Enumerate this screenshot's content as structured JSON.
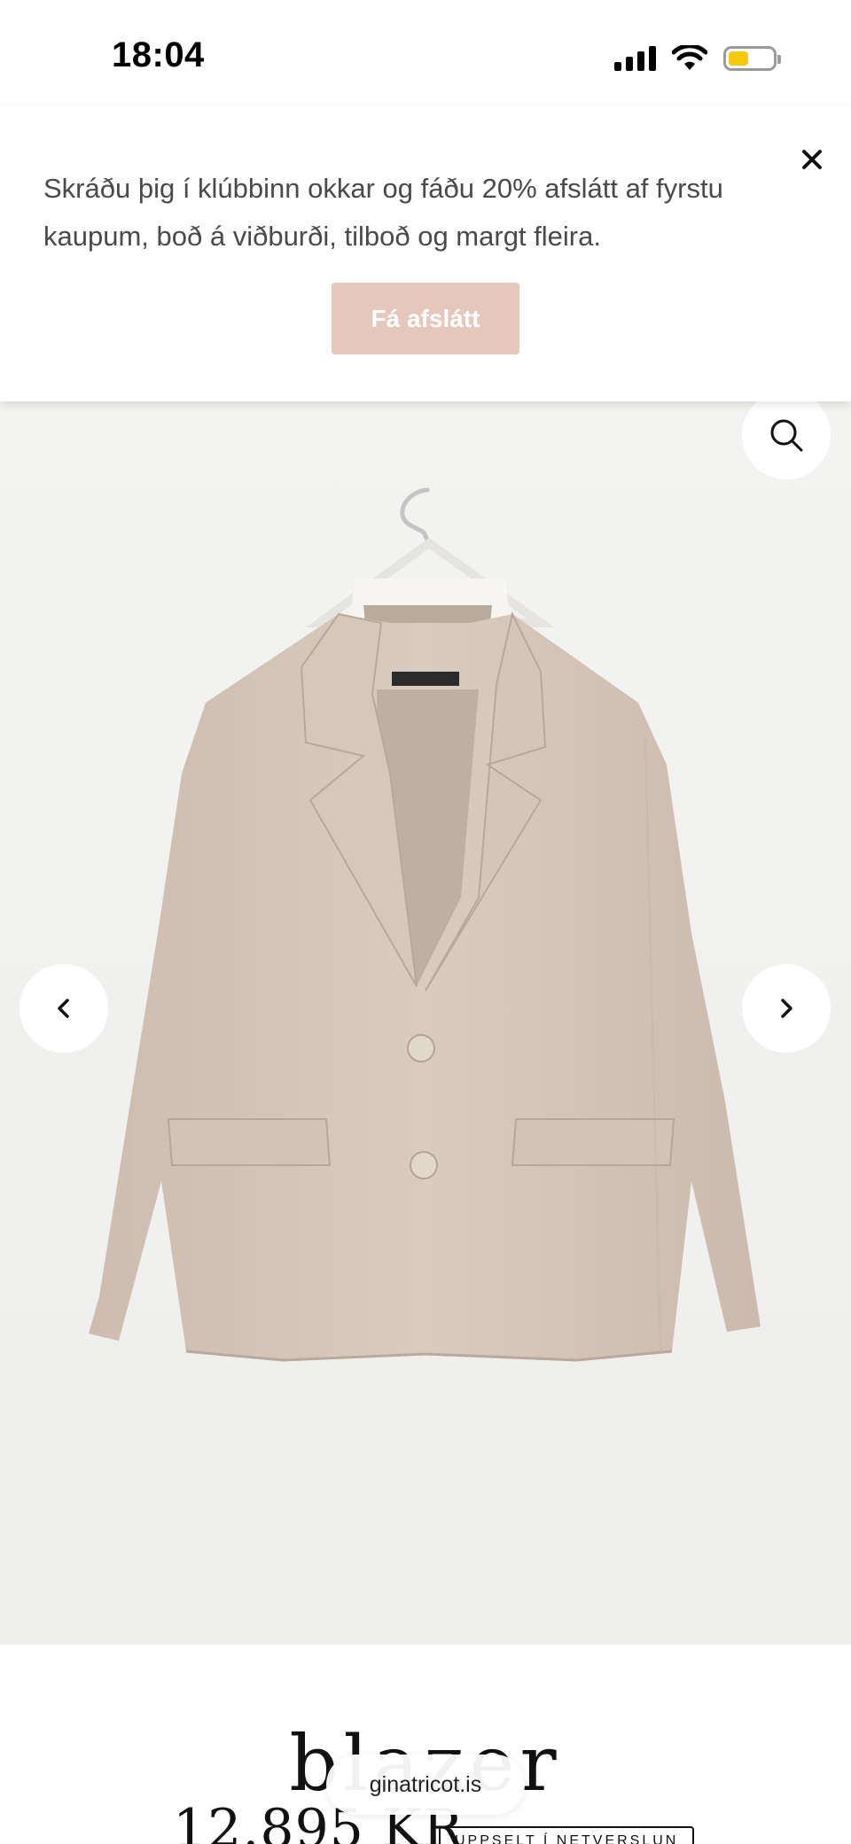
{
  "status_bar": {
    "time": "18:04",
    "battery_level": 0.45,
    "battery_color": "#f6c90e"
  },
  "promo": {
    "text": "Skráðu þig í klúbbinn okkar og fáðu 20% afslátt af fyrstu kaupum, boð á viðburði, tilboð og margt fleira.",
    "button_label": "Fá afslátt",
    "close_icon": "close-icon",
    "button_color": "#e5c8bb"
  },
  "gallery": {
    "zoom_icon": "search-icon",
    "prev_icon": "chevron-left-icon",
    "next_icon": "chevron-right-icon",
    "background_color": "#f1f1ef",
    "product_color": "#d4c5b9"
  },
  "product": {
    "title": "blazer",
    "price": "12.895 KR",
    "stock_status": "UPPSELT Í NETVERSLUN"
  },
  "browser": {
    "url": "ginatricot.is"
  }
}
